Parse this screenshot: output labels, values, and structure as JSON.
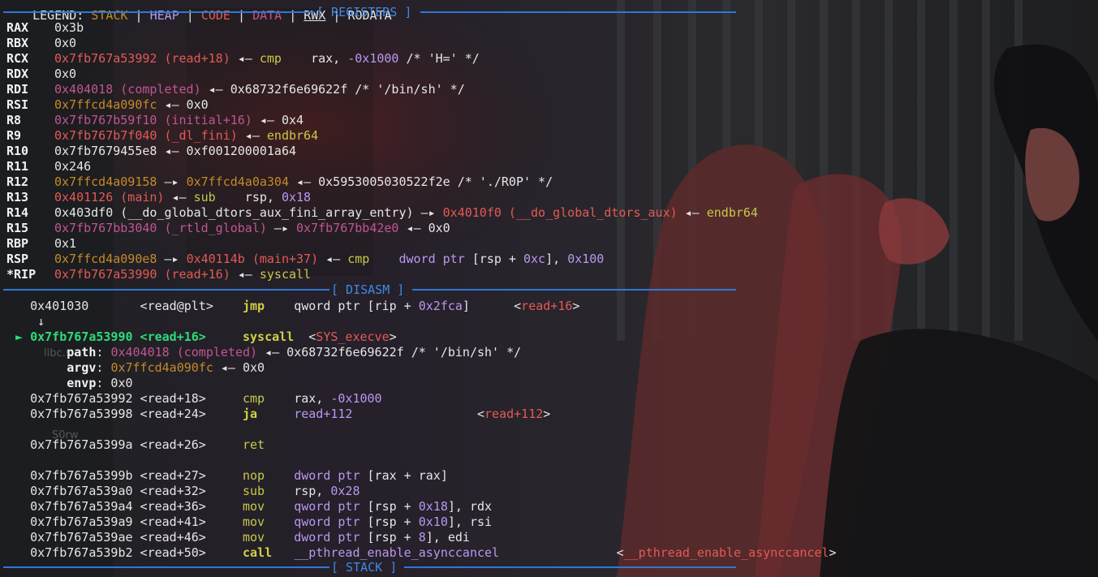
{
  "legend": {
    "label": "LEGEND:",
    "items": [
      "STACK",
      "HEAP",
      "CODE",
      "DATA",
      "RWX",
      "RODATA"
    ],
    "separator": " | "
  },
  "banners": {
    "registers": "[ REGISTERS ]",
    "disasm": "[ DISASM ]",
    "stack": "[ STACK ]"
  },
  "registers": [
    {
      "name": "RAX",
      "segs": [
        {
          "t": "0x3b",
          "c": "w"
        }
      ]
    },
    {
      "name": "RBX",
      "segs": [
        {
          "t": "0x0",
          "c": "w"
        }
      ]
    },
    {
      "name": "RCX",
      "segs": [
        {
          "t": "0x7fb767a53992 (read+18)",
          "c": "r"
        },
        {
          "t": " ◂— ",
          "c": "w"
        },
        {
          "t": "cmp",
          "c": "y"
        },
        {
          "t": "    rax, ",
          "c": "w"
        },
        {
          "t": "-0x1000",
          "c": "p"
        },
        {
          "t": " /* 'H=' */",
          "c": "w"
        }
      ]
    },
    {
      "name": "RDX",
      "segs": [
        {
          "t": "0x0",
          "c": "w"
        }
      ]
    },
    {
      "name": "RDI",
      "segs": [
        {
          "t": "0x404018 (completed)",
          "c": "m"
        },
        {
          "t": " ◂— 0x68732f6e69622f /* '/bin/sh' */",
          "c": "w"
        }
      ]
    },
    {
      "name": "RSI",
      "segs": [
        {
          "t": "0x7ffcd4a090fc",
          "c": "o"
        },
        {
          "t": " ◂— 0x0",
          "c": "w"
        }
      ]
    },
    {
      "name": "R8",
      "segs": [
        {
          "t": "0x7fb767b59f10 (initial+16)",
          "c": "m"
        },
        {
          "t": " ◂— 0x4",
          "c": "w"
        }
      ]
    },
    {
      "name": "R9",
      "segs": [
        {
          "t": "0x7fb767b7f040 (_dl_fini)",
          "c": "r"
        },
        {
          "t": " ◂— ",
          "c": "w"
        },
        {
          "t": "endbr64",
          "c": "y"
        }
      ]
    },
    {
      "name": "R10",
      "segs": [
        {
          "t": "0x7fb7679455e8 ◂— 0xf001200001a64",
          "c": "w"
        }
      ]
    },
    {
      "name": "R11",
      "segs": [
        {
          "t": "0x246",
          "c": "w"
        }
      ]
    },
    {
      "name": "R12",
      "segs": [
        {
          "t": "0x7ffcd4a09158",
          "c": "o"
        },
        {
          "t": " —▸ ",
          "c": "w"
        },
        {
          "t": "0x7ffcd4a0a304",
          "c": "o"
        },
        {
          "t": " ◂— 0x5953005030522f2e /* './R0P' */",
          "c": "w"
        }
      ]
    },
    {
      "name": "R13",
      "segs": [
        {
          "t": "0x401126 (main)",
          "c": "r"
        },
        {
          "t": " ◂— ",
          "c": "w"
        },
        {
          "t": "sub",
          "c": "y"
        },
        {
          "t": "    rsp, ",
          "c": "w"
        },
        {
          "t": "0x18",
          "c": "p"
        }
      ]
    },
    {
      "name": "R14",
      "segs": [
        {
          "t": "0x403df0 (__do_global_dtors_aux_fini_array_entry) —▸ ",
          "c": "w"
        },
        {
          "t": "0x4010f0 (__do_global_dtors_aux)",
          "c": "r"
        },
        {
          "t": " ◂— ",
          "c": "w"
        },
        {
          "t": "endbr64",
          "c": "y"
        }
      ]
    },
    {
      "name": "R15",
      "segs": [
        {
          "t": "0x7fb767bb3040 (_rtld_global)",
          "c": "m"
        },
        {
          "t": " —▸ ",
          "c": "w"
        },
        {
          "t": "0x7fb767bb42e0",
          "c": "m"
        },
        {
          "t": " ◂— 0x0",
          "c": "w"
        }
      ]
    },
    {
      "name": "RBP",
      "segs": [
        {
          "t": "0x1",
          "c": "w"
        }
      ]
    },
    {
      "name": "RSP",
      "segs": [
        {
          "t": "0x7ffcd4a090e8",
          "c": "o"
        },
        {
          "t": " —▸ ",
          "c": "w"
        },
        {
          "t": "0x40114b (main+37)",
          "c": "r"
        },
        {
          "t": " ◂— ",
          "c": "w"
        },
        {
          "t": "cmp",
          "c": "y"
        },
        {
          "t": "    ",
          "c": "w"
        },
        {
          "t": "dword ptr",
          "c": "p"
        },
        {
          "t": " [rsp + ",
          "c": "w"
        },
        {
          "t": "0xc",
          "c": "p"
        },
        {
          "t": "], ",
          "c": "w"
        },
        {
          "t": "0x100",
          "c": "p"
        }
      ]
    },
    {
      "name": "*RIP",
      "segs": [
        {
          "t": "0x7fb767a53990 (read+16)",
          "c": "r"
        },
        {
          "t": " ◂— ",
          "c": "w"
        },
        {
          "t": "syscall",
          "c": "y"
        }
      ]
    }
  ],
  "disasm": [
    {
      "segs": [
        {
          "t": "   0x401030       <read@plt>    ",
          "c": "w"
        },
        {
          "t": "jmp",
          "c": "yb"
        },
        {
          "t": "    qword ptr [rip + ",
          "c": "w"
        },
        {
          "t": "0x2fca",
          "c": "p"
        },
        {
          "t": "]      <",
          "c": "w"
        },
        {
          "t": "read+16",
          "c": "r"
        },
        {
          "t": ">",
          "c": "w"
        }
      ]
    },
    {
      "segs": [
        {
          "t": "    ↓",
          "c": "w"
        }
      ]
    },
    {
      "current": true,
      "segs": [
        {
          "t": " ► 0x7fb767a53990 <read+16>     ",
          "c": "g"
        },
        {
          "t": "syscall",
          "c": "yb"
        },
        {
          "t": "  <",
          "c": "w"
        },
        {
          "t": "SYS_execve",
          "c": "r"
        },
        {
          "t": ">",
          "c": "w"
        }
      ]
    },
    {
      "segs": [
        {
          "t": "        ",
          "c": "w"
        },
        {
          "t": "path",
          "c": "bw"
        },
        {
          "t": ": ",
          "c": "w"
        },
        {
          "t": "0x404018 (completed)",
          "c": "m"
        },
        {
          "t": " ◂— 0x68732f6e69622f /* '/bin/sh' */",
          "c": "w"
        }
      ]
    },
    {
      "segs": [
        {
          "t": "        ",
          "c": "w"
        },
        {
          "t": "argv",
          "c": "bw"
        },
        {
          "t": ": ",
          "c": "w"
        },
        {
          "t": "0x7ffcd4a090fc",
          "c": "o"
        },
        {
          "t": " ◂— 0x0",
          "c": "w"
        }
      ]
    },
    {
      "segs": [
        {
          "t": "        ",
          "c": "w"
        },
        {
          "t": "envp",
          "c": "bw"
        },
        {
          "t": ": 0x0",
          "c": "w"
        }
      ]
    },
    {
      "segs": [
        {
          "t": "   0x7fb767a53992 <read+18>     ",
          "c": "w"
        },
        {
          "t": "cmp",
          "c": "y"
        },
        {
          "t": "    rax, ",
          "c": "w"
        },
        {
          "t": "-0x1000",
          "c": "p"
        }
      ]
    },
    {
      "segs": [
        {
          "t": "   0x7fb767a53998 <read+24>     ",
          "c": "w"
        },
        {
          "t": "ja",
          "c": "yb"
        },
        {
          "t": "     ",
          "c": "w"
        },
        {
          "t": "read+112",
          "c": "p"
        },
        {
          "t": "                 <",
          "c": "w"
        },
        {
          "t": "read+112",
          "c": "r"
        },
        {
          "t": ">",
          "c": "w"
        }
      ]
    },
    {
      "segs": []
    },
    {
      "segs": [
        {
          "t": "   0x7fb767a5399a <read+26>     ",
          "c": "w"
        },
        {
          "t": "ret",
          "c": "y"
        }
      ]
    },
    {
      "segs": []
    },
    {
      "segs": [
        {
          "t": "   0x7fb767a5399b <read+27>     ",
          "c": "w"
        },
        {
          "t": "nop",
          "c": "y"
        },
        {
          "t": "    ",
          "c": "w"
        },
        {
          "t": "dword ptr",
          "c": "p"
        },
        {
          "t": " [rax + rax]",
          "c": "w"
        }
      ]
    },
    {
      "segs": [
        {
          "t": "   0x7fb767a539a0 <read+32>     ",
          "c": "w"
        },
        {
          "t": "sub",
          "c": "y"
        },
        {
          "t": "    rsp, ",
          "c": "w"
        },
        {
          "t": "0x28",
          "c": "p"
        }
      ]
    },
    {
      "segs": [
        {
          "t": "   0x7fb767a539a4 <read+36>     ",
          "c": "w"
        },
        {
          "t": "mov",
          "c": "y"
        },
        {
          "t": "    ",
          "c": "w"
        },
        {
          "t": "qword ptr",
          "c": "p"
        },
        {
          "t": " [rsp + ",
          "c": "w"
        },
        {
          "t": "0x18",
          "c": "p"
        },
        {
          "t": "], rdx",
          "c": "w"
        }
      ]
    },
    {
      "segs": [
        {
          "t": "   0x7fb767a539a9 <read+41>     ",
          "c": "w"
        },
        {
          "t": "mov",
          "c": "y"
        },
        {
          "t": "    ",
          "c": "w"
        },
        {
          "t": "qword ptr",
          "c": "p"
        },
        {
          "t": " [rsp + ",
          "c": "w"
        },
        {
          "t": "0x10",
          "c": "p"
        },
        {
          "t": "], rsi",
          "c": "w"
        }
      ]
    },
    {
      "segs": [
        {
          "t": "   0x7fb767a539ae <read+46>     ",
          "c": "w"
        },
        {
          "t": "mov",
          "c": "y"
        },
        {
          "t": "    ",
          "c": "w"
        },
        {
          "t": "dword ptr",
          "c": "p"
        },
        {
          "t": " [rsp + ",
          "c": "w"
        },
        {
          "t": "8",
          "c": "p"
        },
        {
          "t": "], edi",
          "c": "w"
        }
      ]
    },
    {
      "segs": [
        {
          "t": "   0x7fb767a539b2 <read+50>     ",
          "c": "w"
        },
        {
          "t": "call",
          "c": "yb"
        },
        {
          "t": "   ",
          "c": "w"
        },
        {
          "t": "__pthread_enable_asynccancel",
          "c": "pv"
        },
        {
          "t": "                <",
          "c": "w"
        },
        {
          "t": "__pthread_enable_asynccancel",
          "c": "r"
        },
        {
          "t": ">",
          "c": "w"
        }
      ]
    }
  ],
  "desktop_ghost_labels": [
    "libc.s",
    "S0rw"
  ],
  "colors": {
    "separator": "#2e78d3",
    "banner": "#3f8be4",
    "red": "#e35a54",
    "magenta": "#c25592",
    "yellow": "#c7c94a",
    "orange": "#c58a28",
    "purple": "#b998f0",
    "green": "#2ddb7a"
  }
}
